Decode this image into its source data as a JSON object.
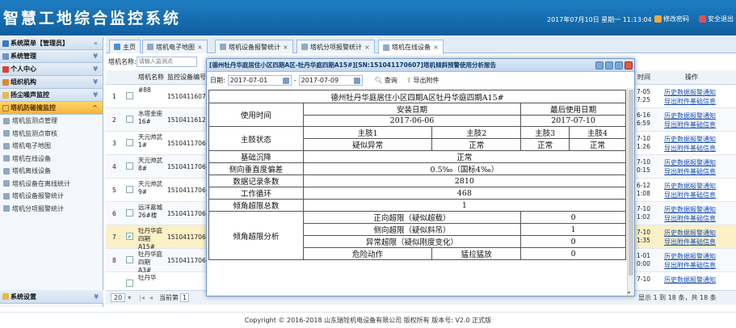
{
  "header": {
    "title": "智慧工地综合监控系统",
    "datetime": "2017年07月10日 星期一 11:13:04",
    "change_password": "修改密码",
    "logout": "安全退出"
  },
  "sidebar": {
    "menu_title": "系统菜单【管理员】",
    "sections": [
      {
        "label": "系统管理"
      },
      {
        "label": "个人中心"
      },
      {
        "label": "组织机构"
      },
      {
        "label": "扬尘噪声监控"
      },
      {
        "label": "塔机防碰撞监控"
      }
    ],
    "sub_items": [
      {
        "label": "塔机监测点管理"
      },
      {
        "label": "塔机监测点审核"
      },
      {
        "label": "塔机电子地图"
      },
      {
        "label": "塔机在线设备"
      },
      {
        "label": "塔机离线设备"
      },
      {
        "label": "塔机设备在离线统计"
      },
      {
        "label": "塔机设备报警统计"
      },
      {
        "label": "塔机分项报警统计"
      }
    ],
    "bottom_section": "系统设置"
  },
  "tabs": [
    {
      "label": "主页"
    },
    {
      "label": "塔机电子地图"
    },
    {
      "label": "塔机设备报警统计"
    },
    {
      "label": "塔机分项报警统计"
    },
    {
      "label": "塔机在线设备"
    }
  ],
  "grid_toolbar": {
    "label": "塔机名称:",
    "placeholder": "请输入监测点"
  },
  "grid": {
    "headers": [
      "塔机名称",
      "监控设备编号"
    ],
    "rows": [
      {
        "num": "1",
        "name": "#88",
        "device": "151041160703"
      },
      {
        "num": "2",
        "name": "水塔金座16#",
        "device": "151041161202"
      },
      {
        "num": "3",
        "name": "天元帅武1#",
        "device": "151041170613"
      },
      {
        "num": "4",
        "name": "天元帅武8#",
        "device": "151041170605"
      },
      {
        "num": "5",
        "name": "天元帅武9#",
        "device": "151041170615"
      },
      {
        "num": "6",
        "name": "远洋嘉城26#楼",
        "device": "151041170612"
      },
      {
        "num": "7",
        "name": "牡丹华庭四期A15#",
        "device": "151041170607"
      },
      {
        "num": "8",
        "name": "牡丹华庭四期A3#",
        "device": "151041170603"
      },
      {
        "num": "",
        "name": "牡丹华",
        "device": ""
      }
    ]
  },
  "right_grid": {
    "headers": [
      "时间",
      "操作"
    ],
    "rows": [
      {
        "time": "7-05 7:25",
        "op1": "历史数据",
        "op2": "报警通知",
        "op3": "导出附件",
        "op4": "基础信息"
      },
      {
        "time": "6-16 6:59",
        "op1": "历史数据",
        "op2": "报警通知",
        "op3": "导出附件",
        "op4": "基础信息"
      },
      {
        "time": "7-10 1:26",
        "op1": "历史数据",
        "op2": "报警通知",
        "op3": "导出附件",
        "op4": "基础信息"
      },
      {
        "time": "7-10 0:15",
        "op1": "历史数据",
        "op2": "报警通知",
        "op3": "导出附件",
        "op4": "基础信息"
      },
      {
        "time": "6-12 1:08",
        "op1": "历史数据",
        "op2": "报警通知",
        "op3": "导出附件",
        "op4": "基础信息"
      },
      {
        "time": "7-10 1:02",
        "op1": "历史数据",
        "op2": "报警通知",
        "op3": "导出附件",
        "op4": "基础信息"
      },
      {
        "time": "7-10 1:35",
        "op1": "历史数据",
        "op2": "报警通知",
        "op3": "导出附件",
        "op4": "基础信息"
      },
      {
        "time": "1-01 0:00",
        "op1": "历史数据",
        "op2": "报警通知",
        "op3": "导出附件",
        "op4": "基础信息"
      },
      {
        "time": "7-10",
        "op1": "历史数据",
        "op2": "报警通知",
        "op3": "",
        "op4": ""
      }
    ]
  },
  "pager": {
    "page_size": "20",
    "current_label": "当前第",
    "current_page": "1",
    "summary": "显示 1 到 18 条，共 18 条"
  },
  "modal": {
    "title": "[德州牡丹华庭居住小区四期A区-牡丹华庭四期A15#][SN:151041170607]塔机倾斜预警使用分析报告",
    "date_label": "日期:",
    "date_from": "2017-07-01",
    "date_sep": "-",
    "date_to": "2017-07-09",
    "query_button": "查询",
    "export_button": "导出附件",
    "report": {
      "heading": "德州牡丹华庭居住小区四期A区牡丹华庭四期A15#",
      "use_time": "使用时间",
      "install_date_label": "安装日期",
      "last_use_date_label": "最后使用日期",
      "install_date": "2017-06-06",
      "last_use_date": "2017-07-10",
      "limb_status": "主肢状态",
      "limb1": "主肢1",
      "limb2": "主肢2",
      "limb3": "主肢3",
      "limb4": "主肢4",
      "limb1_status": "疑似异常",
      "limb2_status": "正常",
      "limb3_status": "正常",
      "limb4_status": "正常",
      "foundation_label": "基础沉降",
      "foundation_value": "正常",
      "verticality_label": "侧向垂直度偏差",
      "verticality_value": "0.5‰（国标4‰）",
      "records_label": "数据记录条数",
      "records_value": "2810",
      "cycles_label": "工作循环",
      "cycles_value": "468",
      "overlimit_total_label": "倾角超限总数",
      "overlimit_total_value": "1",
      "overlimit_analysis_label": "倾角超限分析",
      "forward_label": "正向超限（疑似超载）",
      "forward_value": "0",
      "lateral_label": "侧向超限（疑似斜吊）",
      "lateral_value": "1",
      "abnormal_label": "异常超限（疑似刚度变化）",
      "abnormal_value": "0",
      "danger_label": "危险动作",
      "yank_label": "猛拉猛放",
      "yank_value": "0"
    }
  },
  "footer": "Copyright © 2016-2018 山东瑞铨机电设备有限公司 版权所有    版本号: V2.0    正式版",
  "colors": {
    "header_bg": "#0f5e9e",
    "active_section": "#f5b53a",
    "link": "#1a4fb4"
  }
}
